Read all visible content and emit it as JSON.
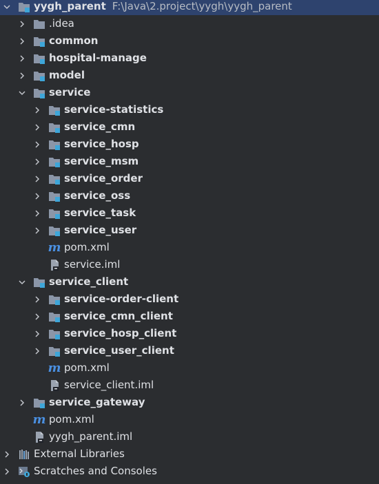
{
  "root": {
    "name": "yygh_parent",
    "path": "F:\\Java\\2.project\\yygh\\yygh_parent"
  },
  "rows": [
    {
      "label": ".idea"
    },
    {
      "label": "common"
    },
    {
      "label": "hospital-manage"
    },
    {
      "label": "model"
    },
    {
      "label": "service"
    },
    {
      "label": "service-statistics"
    },
    {
      "label": "service_cmn"
    },
    {
      "label": "service_hosp"
    },
    {
      "label": "service_msm"
    },
    {
      "label": "service_order"
    },
    {
      "label": "service_oss"
    },
    {
      "label": "service_task"
    },
    {
      "label": "service_user"
    },
    {
      "label": "pom.xml"
    },
    {
      "label": "service.iml"
    },
    {
      "label": "service_client"
    },
    {
      "label": "service-order-client"
    },
    {
      "label": "service_cmn_client"
    },
    {
      "label": "service_hosp_client"
    },
    {
      "label": "service_user_client"
    },
    {
      "label": "pom.xml"
    },
    {
      "label": "service_client.iml"
    },
    {
      "label": "service_gateway"
    },
    {
      "label": "pom.xml"
    },
    {
      "label": "yygh_parent.iml"
    },
    {
      "label": "External Libraries"
    },
    {
      "label": "Scratches and Consoles"
    }
  ],
  "icons": {
    "arrow_collapsed": "chevron-right-icon",
    "arrow_expanded": "chevron-down-icon",
    "folder": "folder-icon",
    "module": "module-folder-icon",
    "maven": "maven-icon",
    "iml": "iml-file-icon",
    "libraries": "libraries-icon",
    "scratches": "scratches-icon"
  },
  "colors": {
    "background": "#2b2d30",
    "selection": "#2e436e",
    "text": "#dfe1e5",
    "folder": "#8b96a8",
    "module_badge": "#3ea6d9",
    "maven": "#4a8fe0"
  }
}
